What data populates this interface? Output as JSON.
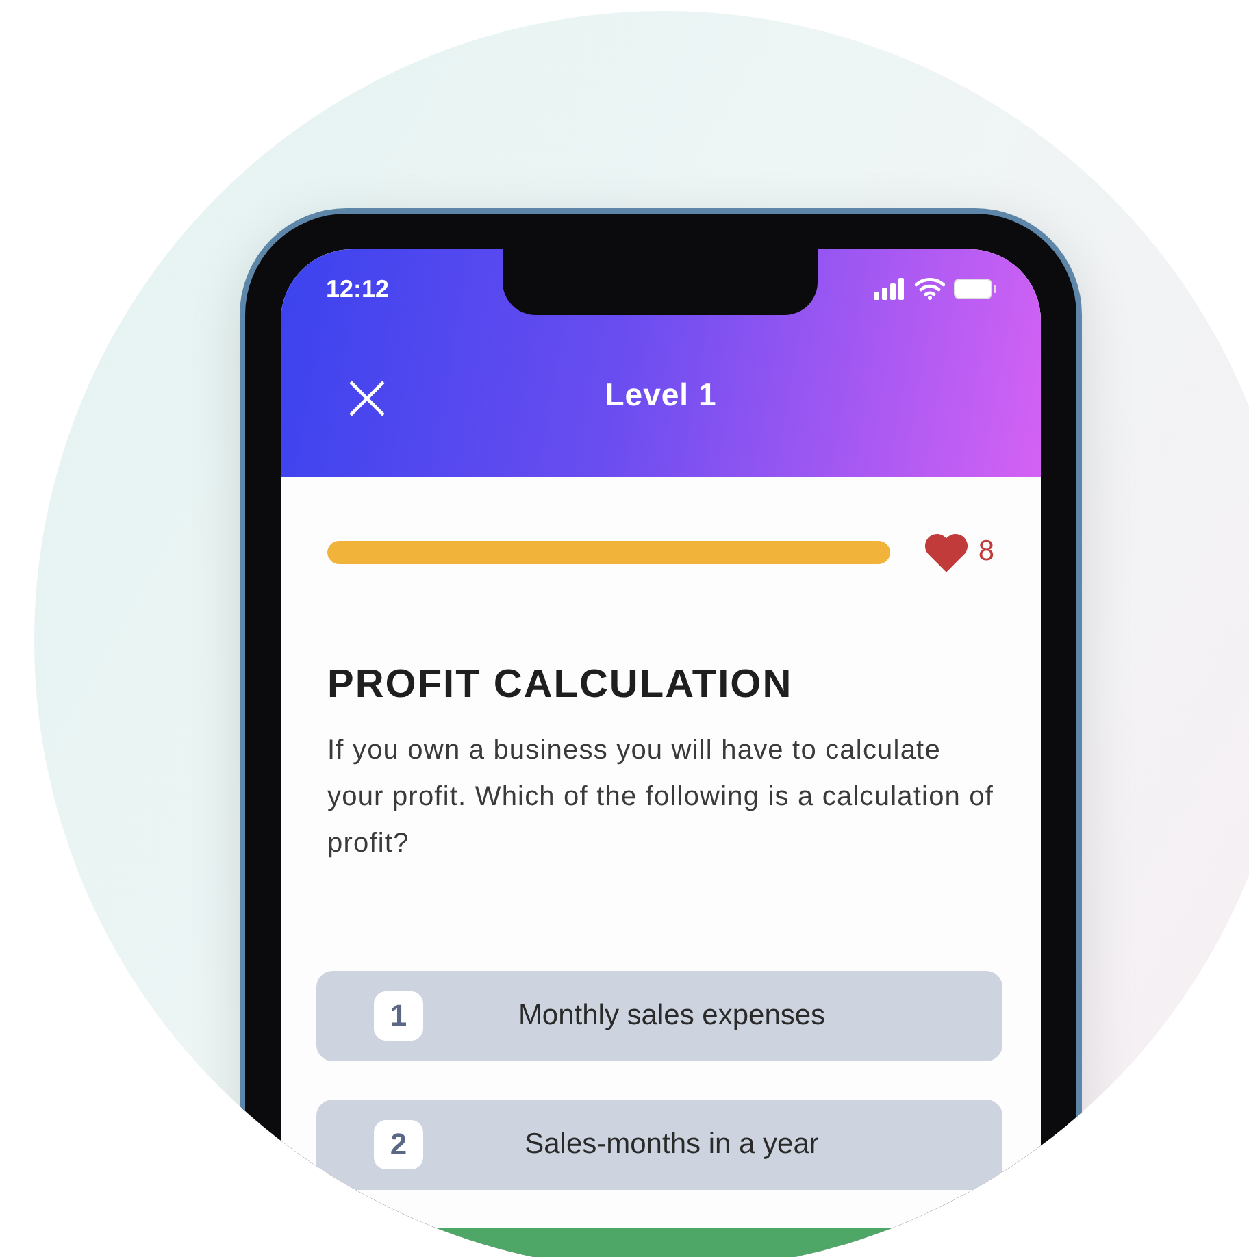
{
  "status_bar": {
    "time": "12:12"
  },
  "header": {
    "title": "Level 1"
  },
  "progress": {
    "level": 1
  },
  "lives": {
    "count": "8"
  },
  "question": {
    "title": "PROFIT CALCULATION",
    "text": "If you own a business you will have to calculate your profit. Which of the following is a calculation of profit?"
  },
  "options": [
    {
      "number": "1",
      "label": "Monthly sales expenses"
    },
    {
      "number": "2",
      "label": "Sales-months in a year"
    }
  ]
}
